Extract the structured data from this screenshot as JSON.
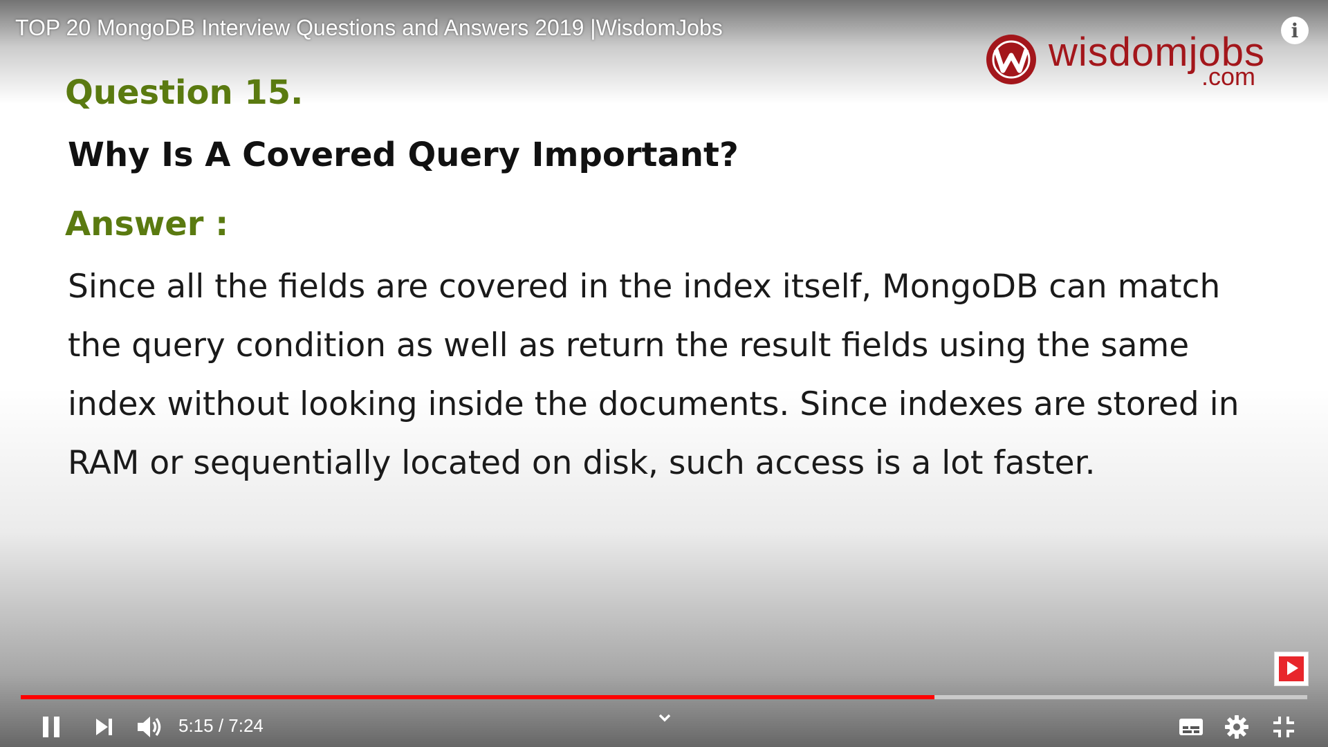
{
  "player": {
    "title": "TOP 20 MongoDB Interview Questions and Answers 2019 |WisdomJobs",
    "info_icon": "info-icon",
    "time_current": "5:15",
    "time_separator": " / ",
    "time_total": "7:24",
    "progress_fraction": 0.71,
    "progress_color": "#ff0000",
    "controls": {
      "play_pause_icon": "pause-icon",
      "next_icon": "next-icon",
      "volume_icon": "volume-icon",
      "more_icon": "chevron-down-icon",
      "captions_icon": "captions-icon",
      "settings_icon": "gear-icon",
      "fullscreen_icon": "exit-fullscreen-icon"
    },
    "subscribe_watermark_icon": "subscribe-icon"
  },
  "slide": {
    "logo": {
      "wordmark": "wisdomjobs",
      "domain": ".com",
      "color": "#a3161b"
    },
    "question_number": "Question 15.",
    "question": "Why Is A Covered Query Important?",
    "answer_label": "Answer :",
    "answer_lines": [
      "Since all the fields are covered in the index itself, MongoDB can match",
      "the query condition as well as return the result fields using the same",
      "index without looking inside the documents. Since indexes are stored in",
      "RAM or sequentially located on disk, such access is a lot faster."
    ],
    "accent_color": "#5a7a10"
  }
}
